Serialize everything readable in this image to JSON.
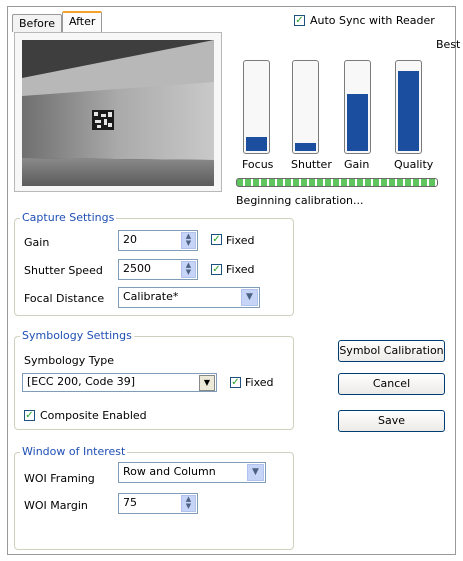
{
  "tabs": [
    {
      "label": "Before",
      "active": false
    },
    {
      "label": "After",
      "active": true
    }
  ],
  "auto_sync": {
    "label": "Auto Sync with Reader",
    "checked": true
  },
  "quality_caption": "Best",
  "meters": [
    {
      "label": "Focus",
      "level": 0.16
    },
    {
      "label": "Shutter",
      "level": 0.09
    },
    {
      "label": "Gain",
      "level": 0.65
    },
    {
      "label": "Quality",
      "level": 0.91
    }
  ],
  "calibration_progress": 1.0,
  "status_text": "Beginning calibration...",
  "capture_settings": {
    "title": "Capture Settings",
    "gain": {
      "label": "Gain",
      "value": "20",
      "fixed_label": "Fixed",
      "fixed": true
    },
    "shutter": {
      "label": "Shutter Speed",
      "value": "2500",
      "fixed_label": "Fixed",
      "fixed": true
    },
    "focal": {
      "label": "Focal Distance",
      "value": "Calibrate*"
    }
  },
  "symbology_settings": {
    "title": "Symbology Settings",
    "type_label": "Symbology Type",
    "type_value": "[ECC 200, Code 39]",
    "fixed_label": "Fixed",
    "fixed": true,
    "composite_label": "Composite Enabled",
    "composite": true
  },
  "woi": {
    "title": "Window of Interest",
    "framing_label": "WOI Framing",
    "framing_value": "Row and Column",
    "margin_label": "WOI Margin",
    "margin_value": "75"
  },
  "buttons": {
    "symbol_calibration": "Symbol Calibration",
    "cancel": "Cancel",
    "save": "Save"
  },
  "colors": {
    "accent_tab": "#f2a12a",
    "meter_fill": "#1b4e9e",
    "progress": "#5ec55e",
    "group_title": "#1f4fb5"
  },
  "icons": {
    "check": "checkmark-icon",
    "spin": "spin-arrows-icon",
    "dropdown": "chevron-down-icon"
  }
}
